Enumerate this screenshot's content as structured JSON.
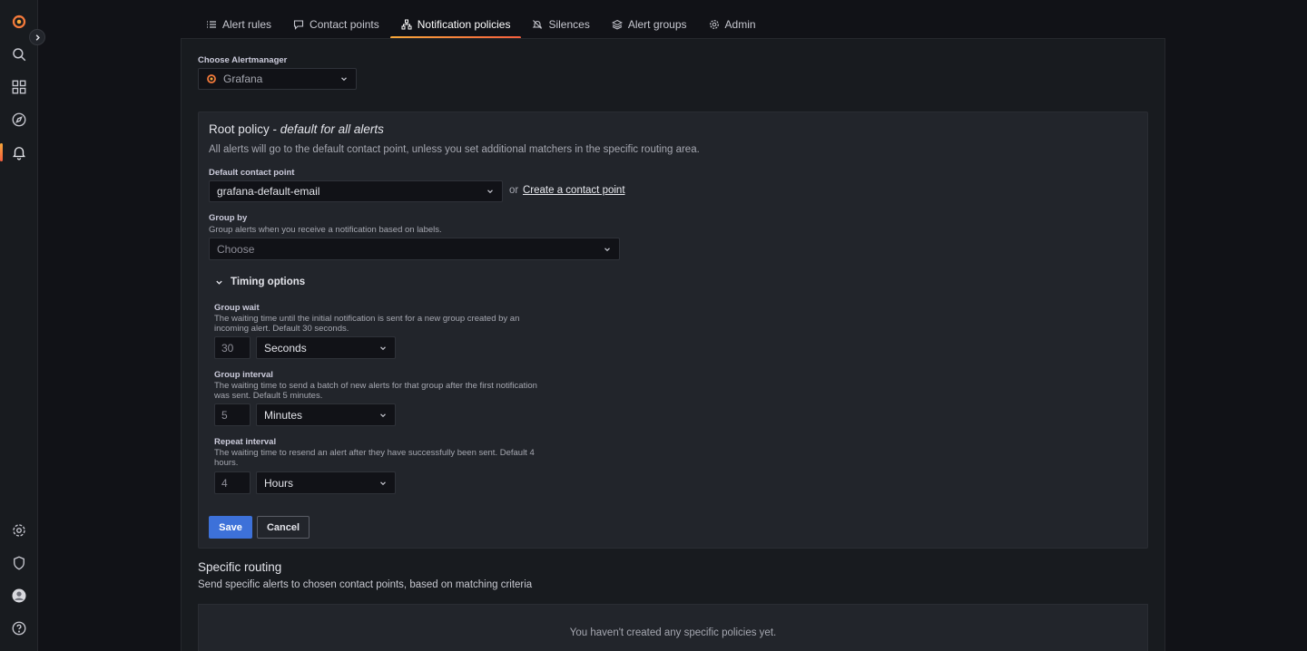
{
  "tabs": [
    {
      "label": "Alert rules",
      "icon": "list-icon"
    },
    {
      "label": "Contact points",
      "icon": "comment-icon"
    },
    {
      "label": "Notification policies",
      "icon": "sitemap-icon",
      "active": true
    },
    {
      "label": "Silences",
      "icon": "bell-slash-icon"
    },
    {
      "label": "Alert groups",
      "icon": "layer-group-icon"
    },
    {
      "label": "Admin",
      "icon": "cog-icon"
    }
  ],
  "alertmanager": {
    "label": "Choose Alertmanager",
    "selected": "Grafana"
  },
  "root_policy": {
    "title": "Root policy - ",
    "title_em": "default for all alerts",
    "description": "All alerts will go to the default contact point, unless you set additional matchers in the specific routing area.",
    "default_contact_point_label": "Default contact point",
    "default_contact_point_value": "grafana-default-email",
    "or_text": "or",
    "create_link": "Create a contact point",
    "group_by_label": "Group by",
    "group_by_desc": "Group alerts when you receive a notification based on labels.",
    "group_by_placeholder": "Choose",
    "timing_options_label": "Timing options",
    "group_wait": {
      "label": "Group wait",
      "desc": "The waiting time until the initial notification is sent for a new group created by an incoming alert. Default 30 seconds.",
      "value": "30",
      "unit": "Seconds"
    },
    "group_interval": {
      "label": "Group interval",
      "desc": "The waiting time to send a batch of new alerts for that group after the first notification was sent. Default 5 minutes.",
      "value": "5",
      "unit": "Minutes"
    },
    "repeat_interval": {
      "label": "Repeat interval",
      "desc": "The waiting time to resend an alert after they have successfully been sent. Default 4 hours.",
      "value": "4",
      "unit": "Hours"
    },
    "save_label": "Save",
    "cancel_label": "Cancel"
  },
  "specific_routing": {
    "title": "Specific routing",
    "description": "Send specific alerts to chosen contact points, based on matching criteria",
    "empty_text": "You haven't created any specific policies yet."
  }
}
